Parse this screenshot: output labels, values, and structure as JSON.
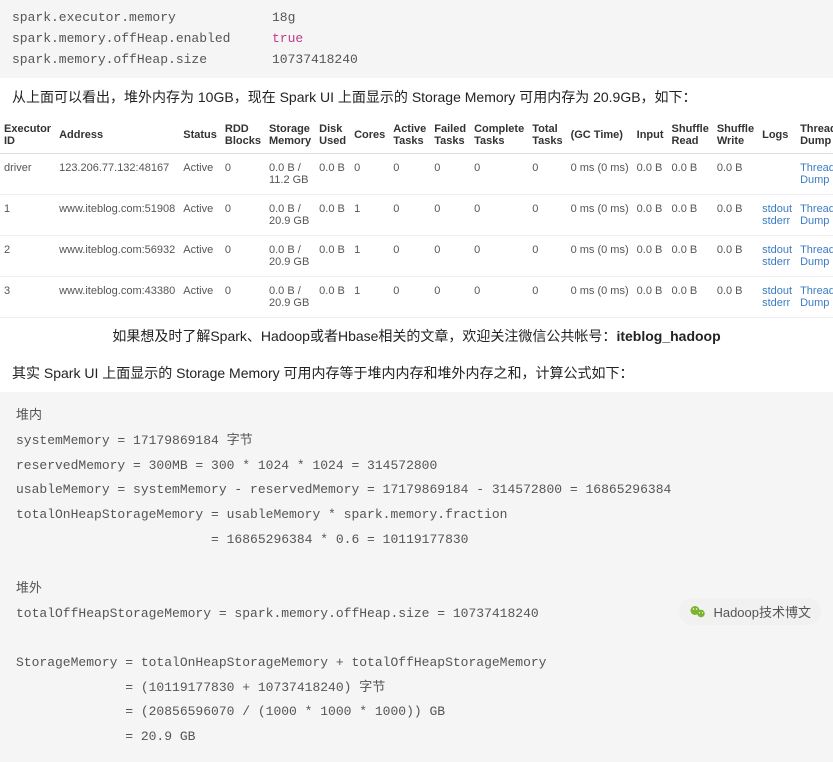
{
  "config": {
    "lines": [
      {
        "key": "spark.executor.memory",
        "val": "18g",
        "kw": false
      },
      {
        "key": "spark.memory.offHeap.enabled",
        "val": "true",
        "kw": true
      },
      {
        "key": "spark.memory.offHeap.size",
        "val": "10737418240",
        "kw": false
      }
    ]
  },
  "para1": "从上面可以看出，堆外内存为 10GB，现在 Spark UI 上面显示的 Storage Memory 可用内存为 20.9GB，如下：",
  "table": {
    "headers": [
      "Executor ID",
      "Address",
      "Status",
      "RDD Blocks",
      "Storage Memory",
      "Disk Used",
      "Cores",
      "Active Tasks",
      "Failed Tasks",
      "Complete Tasks",
      "Total Tasks",
      "(GC Time)",
      "Input",
      "Shuffle Read",
      "Shuffle Write",
      "Logs",
      "Thread Dump"
    ],
    "rows": [
      {
        "id": "driver",
        "address": "123.206.77.132:48167",
        "status": "Active",
        "rdd": "0",
        "storage": "0.0 B / 11.2 GB",
        "disk": "0.0 B",
        "cores": "0",
        "active": "0",
        "failed": "0",
        "complete": "0",
        "total": "0",
        "gc": "0 ms (0 ms)",
        "input": "0.0 B",
        "sread": "0.0 B",
        "swrite": "0.0 B",
        "logs": [],
        "dump": "Thread Dump"
      },
      {
        "id": "1",
        "address": "www.iteblog.com:51908",
        "status": "Active",
        "rdd": "0",
        "storage": "0.0 B / 20.9 GB",
        "disk": "0.0 B",
        "cores": "1",
        "active": "0",
        "failed": "0",
        "complete": "0",
        "total": "0",
        "gc": "0 ms (0 ms)",
        "input": "0.0 B",
        "sread": "0.0 B",
        "swrite": "0.0 B",
        "logs": [
          "stdout",
          "stderr"
        ],
        "dump": "Thread Dump"
      },
      {
        "id": "2",
        "address": "www.iteblog.com:56932",
        "status": "Active",
        "rdd": "0",
        "storage": "0.0 B / 20.9 GB",
        "disk": "0.0 B",
        "cores": "1",
        "active": "0",
        "failed": "0",
        "complete": "0",
        "total": "0",
        "gc": "0 ms (0 ms)",
        "input": "0.0 B",
        "sread": "0.0 B",
        "swrite": "0.0 B",
        "logs": [
          "stdout",
          "stderr"
        ],
        "dump": "Thread Dump"
      },
      {
        "id": "3",
        "address": "www.iteblog.com:43380",
        "status": "Active",
        "rdd": "0",
        "storage": "0.0 B / 20.9 GB",
        "disk": "0.0 B",
        "cores": "1",
        "active": "0",
        "failed": "0",
        "complete": "0",
        "total": "0",
        "gc": "0 ms (0 ms)",
        "input": "0.0 B",
        "sread": "0.0 B",
        "swrite": "0.0 B",
        "logs": [
          "stdout",
          "stderr"
        ],
        "dump": "Thread Dump"
      }
    ]
  },
  "promo": {
    "text": "如果想及时了解Spark、Hadoop或者Hbase相关的文章，欢迎关注微信公共帐号：",
    "bold": "iteblog_hadoop"
  },
  "para2": "其实 Spark UI 上面显示的 Storage Memory 可用内存等于堆内内存和堆外内存之和，计算公式如下：",
  "calc": "堆内\nsystemMemory = 17179869184 字节\nreservedMemory = 300MB = 300 * 1024 * 1024 = 314572800\nusableMemory = systemMemory - reservedMemory = 17179869184 - 314572800 = 16865296384\ntotalOnHeapStorageMemory = usableMemory * spark.memory.fraction\n                         = 16865296384 * 0.6 = 10119177830\n\n堆外\ntotalOffHeapStorageMemory = spark.memory.offHeap.size = 10737418240\n\nStorageMemory = totalOnHeapStorageMemory + totalOffHeapStorageMemory\n              = (10119177830 + 10737418240) 字节\n              = (20856596070 / (1000 * 1000 * 1000)) GB\n              = 20.9 GB",
  "watermark": "Hadoop技术博文"
}
